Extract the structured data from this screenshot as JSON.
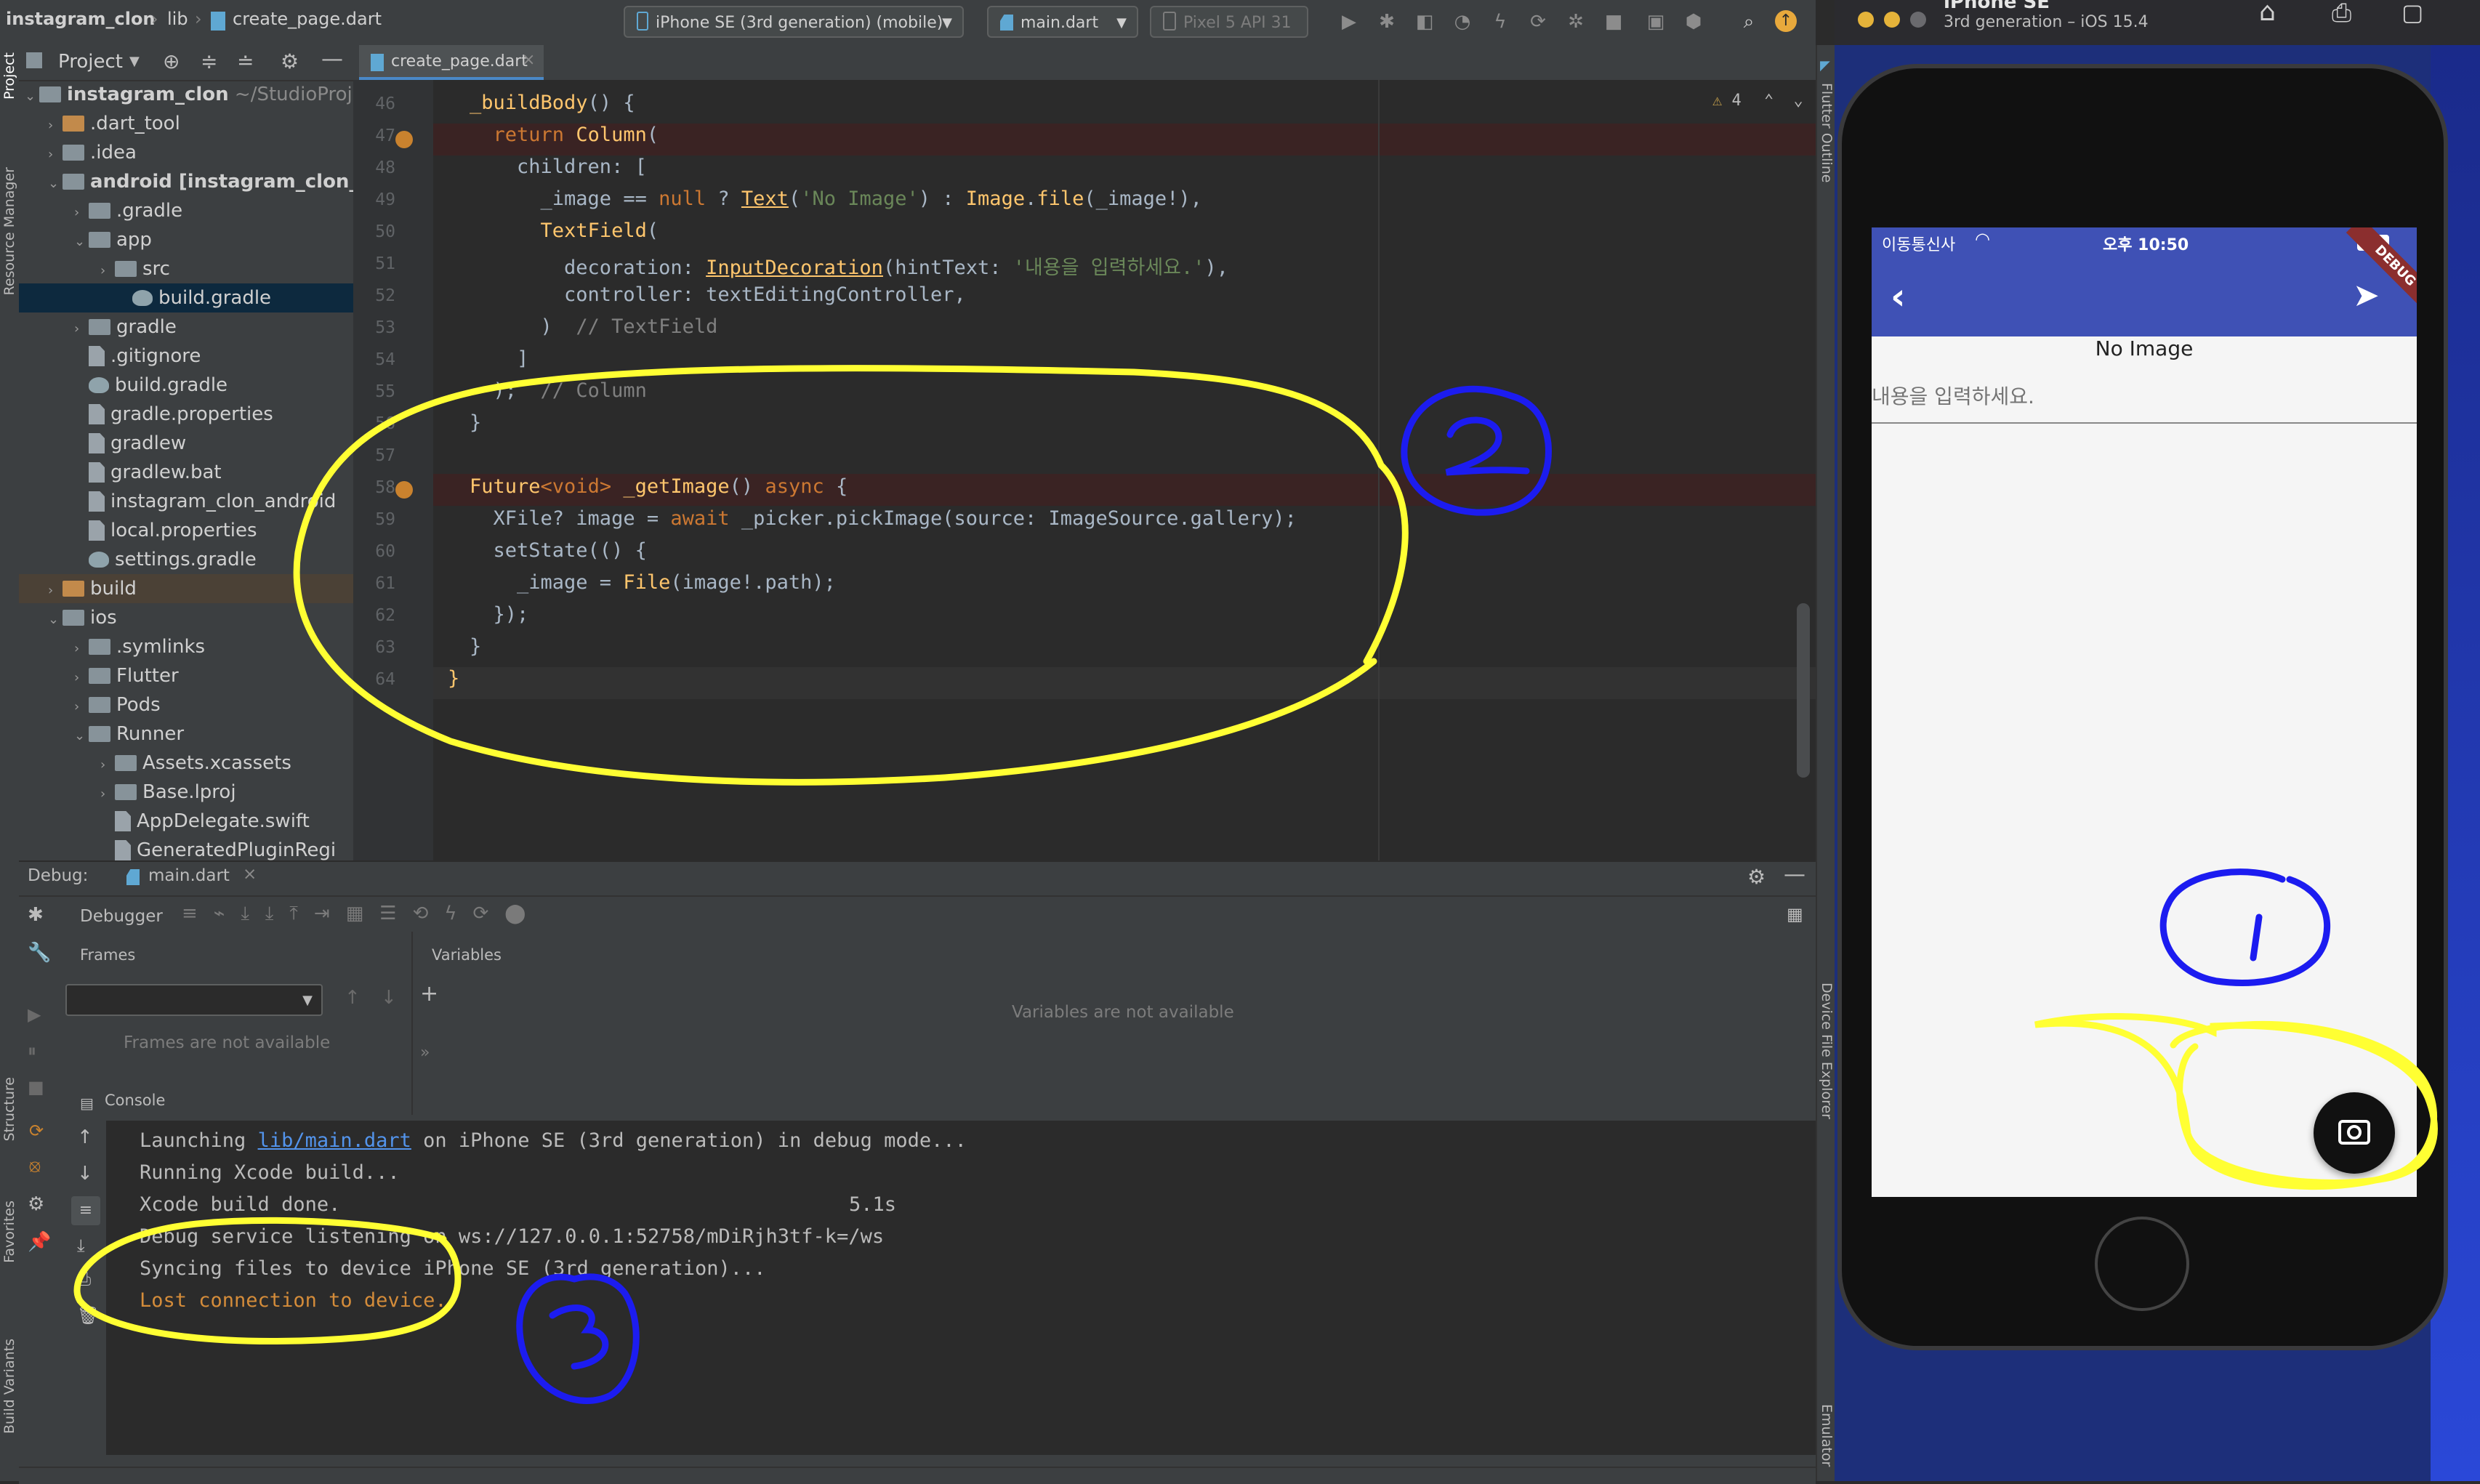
{
  "navbar": {
    "project": "instagram_clon",
    "lib": "lib",
    "file": "create_page.dart",
    "device": "iPhone SE (3rd generation) (mobile)",
    "config": "main.dart",
    "emulator": "Pixel 5 API 31"
  },
  "project_panel": {
    "title": "Project",
    "tree": [
      {
        "label": "instagram_clon",
        "hint": "~/StudioProj",
        "bold": true
      },
      {
        "label": ".dart_tool"
      },
      {
        "label": ".idea"
      },
      {
        "label": "android [instagram_clon_a",
        "bold": true
      },
      {
        "label": ".gradle"
      },
      {
        "label": "app"
      },
      {
        "label": "src"
      },
      {
        "label": "build.gradle"
      },
      {
        "label": "gradle"
      },
      {
        "label": ".gitignore"
      },
      {
        "label": "build.gradle"
      },
      {
        "label": "gradle.properties"
      },
      {
        "label": "gradlew"
      },
      {
        "label": "gradlew.bat"
      },
      {
        "label": "instagram_clon_android"
      },
      {
        "label": "local.properties"
      },
      {
        "label": "settings.gradle"
      },
      {
        "label": "build"
      },
      {
        "label": "ios"
      },
      {
        "label": ".symlinks"
      },
      {
        "label": "Flutter"
      },
      {
        "label": "Pods"
      },
      {
        "label": "Runner"
      },
      {
        "label": "Assets.xcassets"
      },
      {
        "label": "Base.lproj"
      },
      {
        "label": "AppDelegate.swift"
      },
      {
        "label": "GeneratedPluginRegi"
      }
    ]
  },
  "editor": {
    "tab": "create_page.dart",
    "warnings": "4",
    "line_numbers": [
      "46",
      "47",
      "48",
      "49",
      "50",
      "51",
      "52",
      "53",
      "54",
      "55",
      "56",
      "57",
      "58",
      "59",
      "60",
      "61",
      "62",
      "63",
      "64"
    ]
  },
  "side_labels": {
    "project": "Project",
    "resource_manager": "Resource Manager",
    "structure": "Structure",
    "favorites": "Favorites",
    "build_variants": "Build Variants",
    "flutter_outline": "Flutter Outline",
    "device_explorer": "Device File Explorer",
    "emulator": "Emulator"
  },
  "debug": {
    "label": "Debug:",
    "tab": "main.dart",
    "debugger": "Debugger",
    "frames": "Frames",
    "variables": "Variables",
    "frames_empty": "Frames are not available",
    "variables_empty": "Variables are not available",
    "console": "Console",
    "console_lines": {
      "l1_pre": "Launching ",
      "l1_link": "lib/main.dart",
      "l1_post": " on iPhone SE (3rd generation) in debug mode...",
      "l2": "Running Xcode build...",
      "l3": "Xcode build done.",
      "l3_time": "5.1s",
      "l4": "Debug service listening on ws://127.0.0.1:52758/mDiRjh3tf-k=/ws",
      "l5": "Syncing files to device iPhone SE (3rd generation)...",
      "l6": "Lost connection to device."
    }
  },
  "simulator": {
    "title": "iPhone SE",
    "subtitle": "3rd generation – iOS 15.4",
    "carrier": "이동통신사",
    "time": "오후 10:50",
    "debug_banner": "DEBUG",
    "no_image": "No Image",
    "hint": "내용을 입력하세요."
  },
  "colors": {
    "ide_bg": "#2b2b2b",
    "panel_bg": "#3c3f41",
    "appbar": "#3f51b5",
    "annotation_yellow": "#ffff33",
    "annotation_blue": "#1c1cf0"
  }
}
